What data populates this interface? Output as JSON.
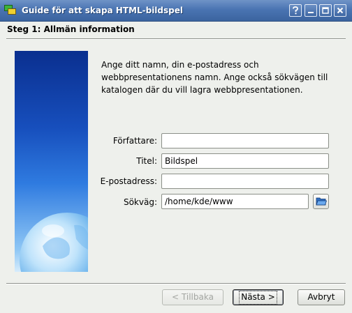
{
  "window": {
    "title": "Guide för att skapa HTML-bildspel",
    "title_buttons": [
      "help-icon",
      "minimize-icon",
      "maximize-icon",
      "close-icon"
    ]
  },
  "header": {
    "step_title": "Steg 1: Allmän information"
  },
  "intro": {
    "text": "Ange ditt namn, din e-postadress och webbpresentationens namn. Ange också sökvägen till katalogen där du vill lagra webbpresentationen."
  },
  "form": {
    "author_label": "Författare:",
    "author_value": "",
    "title_label": "Titel:",
    "title_value": "Bildspel",
    "email_label": "E-postadress:",
    "email_value": "",
    "path_label": "Sökväg:",
    "path_value": "/home/kde/www",
    "browse_icon": "folder-open-icon"
  },
  "buttons": {
    "back_label": "< Tillbaka",
    "next_label": "Nästa >",
    "cancel_label": "Avbryt"
  },
  "colors": {
    "titlebar": "#4a74b2",
    "background": "#eef0ec",
    "side_image_top": "#0a2f8f",
    "side_image_bottom": "#d6ecfc"
  }
}
